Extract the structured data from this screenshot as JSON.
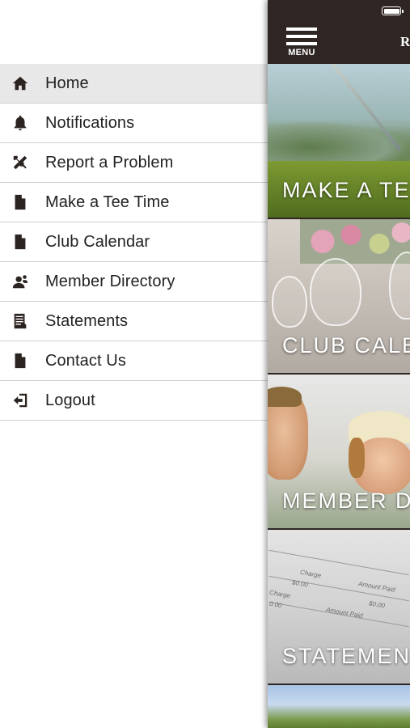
{
  "drawer": {
    "items": [
      {
        "label": "Home",
        "icon": "home-icon",
        "active": true
      },
      {
        "label": "Notifications",
        "icon": "bell-icon",
        "active": false
      },
      {
        "label": "Report a Problem",
        "icon": "tools-icon",
        "active": false
      },
      {
        "label": "Make a Tee Time",
        "icon": "document-icon",
        "active": false
      },
      {
        "label": "Club Calendar",
        "icon": "document-icon",
        "active": false
      },
      {
        "label": "Member Directory",
        "icon": "members-icon",
        "active": false
      },
      {
        "label": "Statements",
        "icon": "statement-icon",
        "active": false
      },
      {
        "label": "Contact Us",
        "icon": "document-icon",
        "active": false
      },
      {
        "label": "Logout",
        "icon": "logout-icon",
        "active": false
      }
    ]
  },
  "header": {
    "menu_label": "MENU",
    "title": "R"
  },
  "tiles": [
    {
      "caption": "MAKE A TE"
    },
    {
      "caption": "CLUB CALE"
    },
    {
      "caption": "MEMBER D"
    },
    {
      "caption": "STATEMEN"
    }
  ],
  "statement_image": {
    "labels": [
      "Charge",
      "Amount Paid",
      "Charge",
      "Amount Paid",
      "$0.00",
      "$0.00",
      "0.00"
    ]
  },
  "colors": {
    "header_bg": "#2f2624",
    "active_item_bg": "#e8e8e8",
    "icon_color": "#2b2320",
    "divider": "#cfcfcf"
  }
}
